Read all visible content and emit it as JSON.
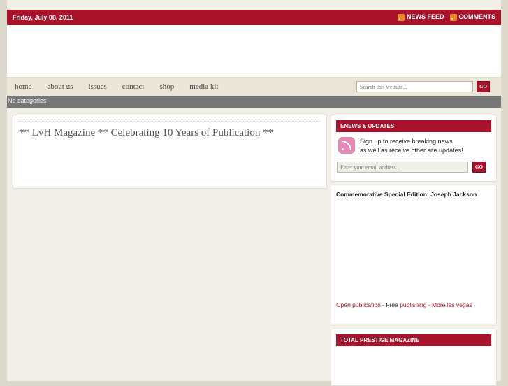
{
  "topbar": {
    "date": "Friday, July 08, 2011",
    "news_feed": "NEWS FEED",
    "comments": "COMMENTS",
    "accent": "#a8122a"
  },
  "nav": {
    "items": [
      "home",
      "about us",
      "issues",
      "contact",
      "shop",
      "media kit"
    ],
    "search_placeholder": "Search this website...",
    "go": "GO"
  },
  "categories_text": "No categories",
  "main": {
    "heading": "** LvH Magazine ** Celebrating 10 Years of Publication **"
  },
  "sidebar": {
    "enews": {
      "title": "ENEWS & UPDATES",
      "line1": "Sign up to receive breaking news",
      "line2": "as well as receive other site updates!",
      "email_placeholder": "Enter your email address...",
      "go": "GO"
    },
    "publication": {
      "title": "Commemorative Special Edition: Joseph Jackson",
      "link1": "Open publication",
      "sep1": " - Free ",
      "link2": "publishing",
      "sep2": " - ",
      "link3": "More las vegas"
    },
    "prestige": {
      "title": "TOTAL PRESTIGE MAGAZINE"
    }
  }
}
